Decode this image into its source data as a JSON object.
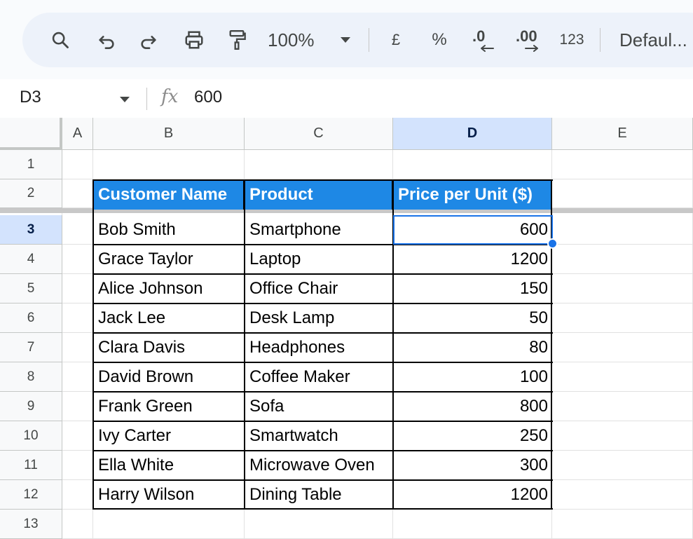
{
  "toolbar": {
    "zoom": "100%",
    "currency": "£",
    "percent": "%",
    "decrease_decimal": ".0",
    "increase_decimal": ".00",
    "more_formats": "123",
    "font": "Defaul..."
  },
  "formula_bar": {
    "cell_ref": "D3",
    "fx": "fx",
    "value": "600"
  },
  "columns": [
    "A",
    "B",
    "C",
    "D",
    "E"
  ],
  "selected_column": "D",
  "selected_row": "3",
  "rows": [
    "1",
    "2",
    "3",
    "4",
    "5",
    "6",
    "7",
    "8",
    "9",
    "10",
    "11",
    "12",
    "13"
  ],
  "table": {
    "headers": [
      "Customer Name",
      "Product",
      "Price per Unit ($)"
    ],
    "data": [
      [
        "Bob Smith",
        "Smartphone",
        "600"
      ],
      [
        "Grace Taylor",
        "Laptop",
        "1200"
      ],
      [
        "Alice Johnson",
        "Office Chair",
        "150"
      ],
      [
        "Jack Lee",
        "Desk Lamp",
        "50"
      ],
      [
        "Clara Davis",
        "Headphones",
        "80"
      ],
      [
        "David Brown",
        "Coffee Maker",
        "100"
      ],
      [
        "Frank Green",
        "Sofa",
        "800"
      ],
      [
        "Ivy Carter",
        "Smartwatch",
        "250"
      ],
      [
        "Ella White",
        "Microwave Oven",
        "300"
      ],
      [
        "Harry Wilson",
        "Dining Table",
        "1200"
      ]
    ]
  },
  "colors": {
    "header_fill": "#1e88e5",
    "selection": "#1a73e8",
    "selected_header": "#d3e3fd"
  }
}
